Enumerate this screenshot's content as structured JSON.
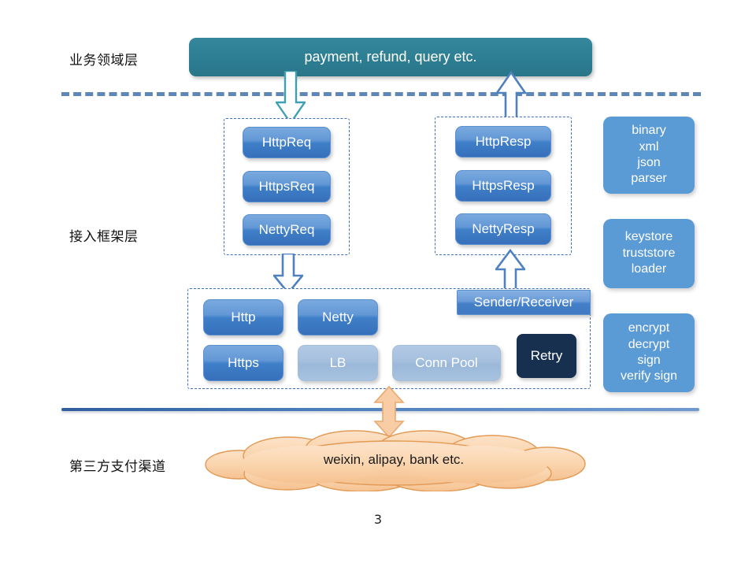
{
  "page": {
    "number": "3"
  },
  "layers": [
    {
      "label": "业务领域层"
    },
    {
      "label": "接入框架层"
    },
    {
      "label": "第三方支付渠道"
    }
  ],
  "domain_bar": {
    "label": "payment, refund, query etc."
  },
  "request_group": {
    "items": [
      {
        "label": "HttpReq"
      },
      {
        "label": "HttpsReq"
      },
      {
        "label": "NettyReq"
      }
    ]
  },
  "response_group": {
    "items": [
      {
        "label": "HttpResp"
      },
      {
        "label": "HttpsResp"
      },
      {
        "label": "NettyResp"
      }
    ]
  },
  "transport_group": {
    "items": [
      {
        "label": "Http",
        "style": "blue"
      },
      {
        "label": "Netty",
        "style": "blue"
      },
      {
        "label": "Https",
        "style": "blue"
      },
      {
        "label": "LB",
        "style": "lightblue"
      },
      {
        "label": "Conn Pool",
        "style": "lightblue"
      },
      {
        "label": "Retry",
        "style": "navy"
      }
    ],
    "sender_receiver": "Sender/Receiver"
  },
  "sidebar": {
    "items": [
      {
        "lines": [
          "binary",
          "xml",
          "json",
          "parser"
        ]
      },
      {
        "lines": [
          "keystore",
          "truststore",
          "loader"
        ]
      },
      {
        "lines": [
          "encrypt",
          "decrypt",
          "sign",
          "verify sign"
        ]
      }
    ]
  },
  "cloud": {
    "label": "weixin, alipay, bank etc."
  },
  "colors": {
    "teal_bar": "#2d7e93",
    "chip_blue": "#3f7fc8",
    "chip_lightblue": "#a5c0de",
    "chip_navy": "#18304f",
    "sidebar_blue": "#5b9bd5",
    "divider_blue": "#4472a8",
    "cloud_fill": "#f8caa0",
    "cloud_stroke": "#e0934c",
    "arrow_teal": "#3fa0b4",
    "arrow_blue": "#4e81bd",
    "arrow_peach": "#f5c49a"
  }
}
